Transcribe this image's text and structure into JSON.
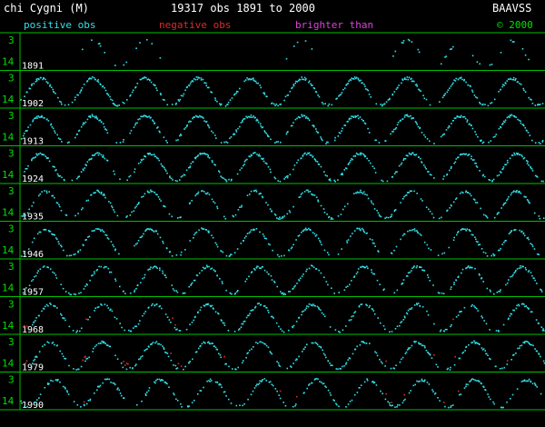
{
  "header": {
    "star": "chi Cygni (M)",
    "summary": "19317 obs 1891 to 2000",
    "org": "BAAVSS",
    "copyright": "© 2000"
  },
  "legend": {
    "positive": "positive obs",
    "negative": "negative obs",
    "brighter": "brighter than"
  },
  "colors": {
    "positive": "#33e0e8",
    "negative": "#e02828",
    "brighter": "#e040e0",
    "grid": "#00c000",
    "axis_text": "#00e000",
    "text": "#ffffff"
  },
  "chart_data": {
    "type": "scatter",
    "x_unit": "year",
    "y_unit": "magnitude",
    "y_inverted": true,
    "y_range": [
      3,
      14
    ],
    "y_tick_labels": [
      "3",
      "14"
    ],
    "period_days": 408,
    "panel_start_years": [
      1891,
      1902,
      1913,
      1924,
      1935,
      1946,
      1957,
      1968,
      1979,
      1990
    ],
    "panel_span_years": 11,
    "maxima_approx_years": [
      1892.5,
      1893.6,
      1896.9,
      1899.1,
      1901.3,
      1902.4,
      1903.5,
      1904.6,
      1905.7,
      1906.8,
      1907.9,
      1909.0,
      1910.1,
      1911.2,
      1912.3,
      1913.4,
      1914.5,
      1915.6,
      1916.7,
      1917.8,
      1918.9,
      1920.0,
      1921.1,
      1922.2,
      1923.3,
      1924.4,
      1925.6,
      1926.7,
      1927.8,
      1928.9,
      1930.0,
      1931.1,
      1932.2,
      1933.3,
      1934.4,
      1935.5,
      1936.6,
      1937.7,
      1938.8,
      1939.9,
      1941.0,
      1942.1,
      1943.2,
      1944.3,
      1945.4,
      1946.5,
      1947.6,
      1948.7,
      1949.8,
      1950.9,
      1952.0,
      1953.1,
      1954.2,
      1955.3,
      1956.4,
      1957.5,
      1958.7,
      1959.8,
      1960.9,
      1962.0,
      1963.1,
      1964.2,
      1965.3,
      1966.4,
      1967.5,
      1968.6,
      1969.7,
      1970.8,
      1971.9,
      1973.0,
      1974.1,
      1975.2,
      1976.3,
      1977.4,
      1978.5,
      1979.6,
      1980.7,
      1981.8,
      1982.9,
      1984.0,
      1985.1,
      1986.2,
      1987.3,
      1988.5,
      1989.6,
      1990.7,
      1991.8,
      1992.9,
      1994.0,
      1995.1,
      1996.2,
      1997.3,
      1998.4,
      1999.5
    ],
    "maximum_magnitude_approx": 4.5,
    "minimum_magnitude_approx": 13.8,
    "series": [
      {
        "name": "positive obs",
        "color": "#33e0e8"
      },
      {
        "name": "negative obs",
        "color": "#e02828"
      },
      {
        "name": "brighter than",
        "color": "#e040e0"
      }
    ]
  }
}
